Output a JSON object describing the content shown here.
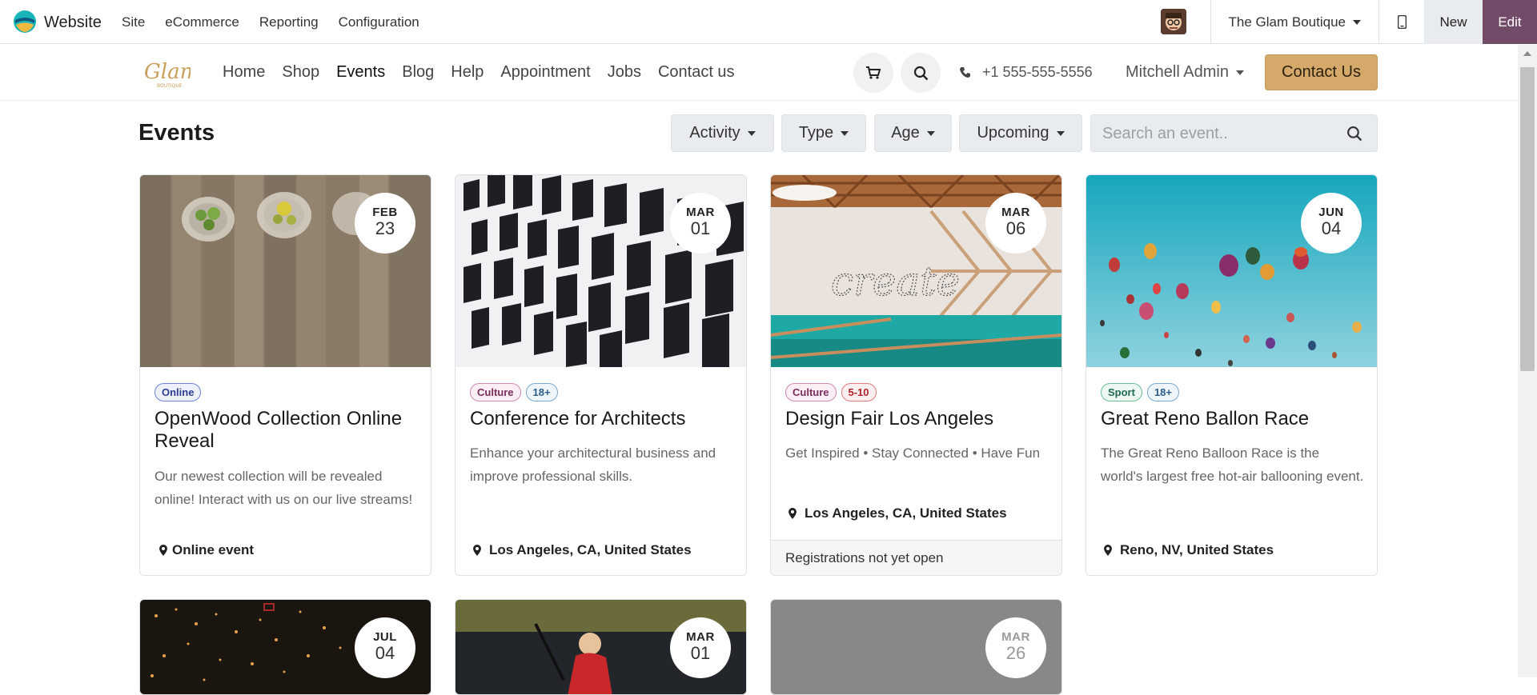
{
  "odoo_bar": {
    "app_name": "Website",
    "menu": [
      "Site",
      "eCommerce",
      "Reporting",
      "Configuration"
    ],
    "company": "The Glam Boutique",
    "new_label": "New",
    "edit_label": "Edit",
    "edit_color": "#714b67"
  },
  "site_header": {
    "nav": [
      "Home",
      "Shop",
      "Events",
      "Blog",
      "Help",
      "Appointment",
      "Jobs",
      "Contact us"
    ],
    "active_nav": "Events",
    "phone": "+1 555-555-5556",
    "user": "Mitchell Admin",
    "contact_button": "Contact Us",
    "accent_color": "#d4a96a"
  },
  "events": {
    "title": "Events",
    "filters": [
      "Activity",
      "Type",
      "Age",
      "Upcoming"
    ],
    "search_placeholder": "Search an event.."
  },
  "cards": [
    {
      "month": "FEB",
      "day": "23",
      "tags": [
        {
          "label": "Online",
          "kind": "online"
        }
      ],
      "title": "OpenWood Collection Online Reveal",
      "desc": "Our newest collection will be revealed online! Interact with us on our live streams!",
      "location": "Online event",
      "footer": ""
    },
    {
      "month": "MAR",
      "day": "01",
      "tags": [
        {
          "label": "Culture",
          "kind": "culture"
        },
        {
          "label": "18+",
          "kind": "age18"
        }
      ],
      "title": "Conference for Architects",
      "desc": "Enhance your architectural business and improve professional skills.",
      "location": "Los Angeles, CA, United States",
      "footer": ""
    },
    {
      "month": "MAR",
      "day": "06",
      "tags": [
        {
          "label": "Culture",
          "kind": "culture"
        },
        {
          "label": "5-10",
          "kind": "age510"
        }
      ],
      "title": "Design Fair Los Angeles",
      "desc": "Get Inspired • Stay Connected • Have Fun",
      "location": "Los Angeles, CA, United States",
      "footer": "Registrations not yet open"
    },
    {
      "month": "JUN",
      "day": "04",
      "tags": [
        {
          "label": "Sport",
          "kind": "sport"
        },
        {
          "label": "18+",
          "kind": "age18"
        }
      ],
      "title": "Great Reno Ballon Race",
      "desc": "The Great Reno Balloon Race is the world's largest free hot-air ballooning event.",
      "location": "Reno, NV, United States",
      "footer": ""
    },
    {
      "month": "JUL",
      "day": "04"
    },
    {
      "month": "MAR",
      "day": "01"
    },
    {
      "month": "MAR",
      "day": "26"
    }
  ]
}
